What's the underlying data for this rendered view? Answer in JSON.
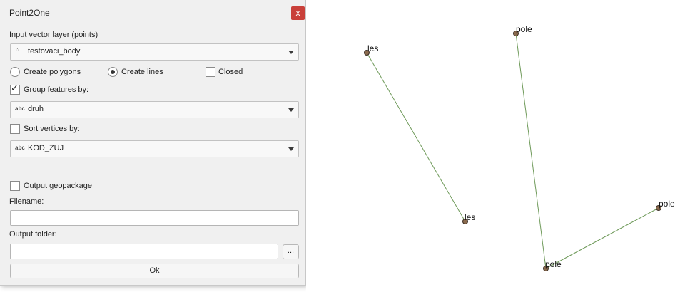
{
  "dialog": {
    "title": "Point2One",
    "close_glyph": "x",
    "input_layer_label": "Input vector layer (points)",
    "input_layer_value": "testovaci_body",
    "create_polygons_label": "Create polygons",
    "create_lines_label": "Create lines",
    "closed_label": "Closed",
    "create_polygons_selected": false,
    "create_lines_selected": true,
    "closed_checked": false,
    "group_features_label": "Group features by:",
    "group_features_checked": true,
    "group_field": "druh",
    "sort_vertices_label": "Sort vertices by:",
    "sort_vertices_checked": false,
    "sort_field": "KOD_ZUJ",
    "field_type_badge": "abc",
    "output_geopackage_label": "Output geopackage",
    "output_geopackage_checked": false,
    "filename_label": "Filename:",
    "filename_value": "",
    "output_folder_label": "Output folder:",
    "output_folder_value": "",
    "browse_label": "...",
    "ok_label": "Ok"
  },
  "map": {
    "line_color": "#6f9a5a",
    "point_fill": "#8a6a4d",
    "point_stroke": "#3c2f25",
    "points": [
      {
        "label": "les"
      },
      {
        "label": "les"
      },
      {
        "label": "pole"
      },
      {
        "label": "pole"
      },
      {
        "label": "pole"
      }
    ]
  }
}
